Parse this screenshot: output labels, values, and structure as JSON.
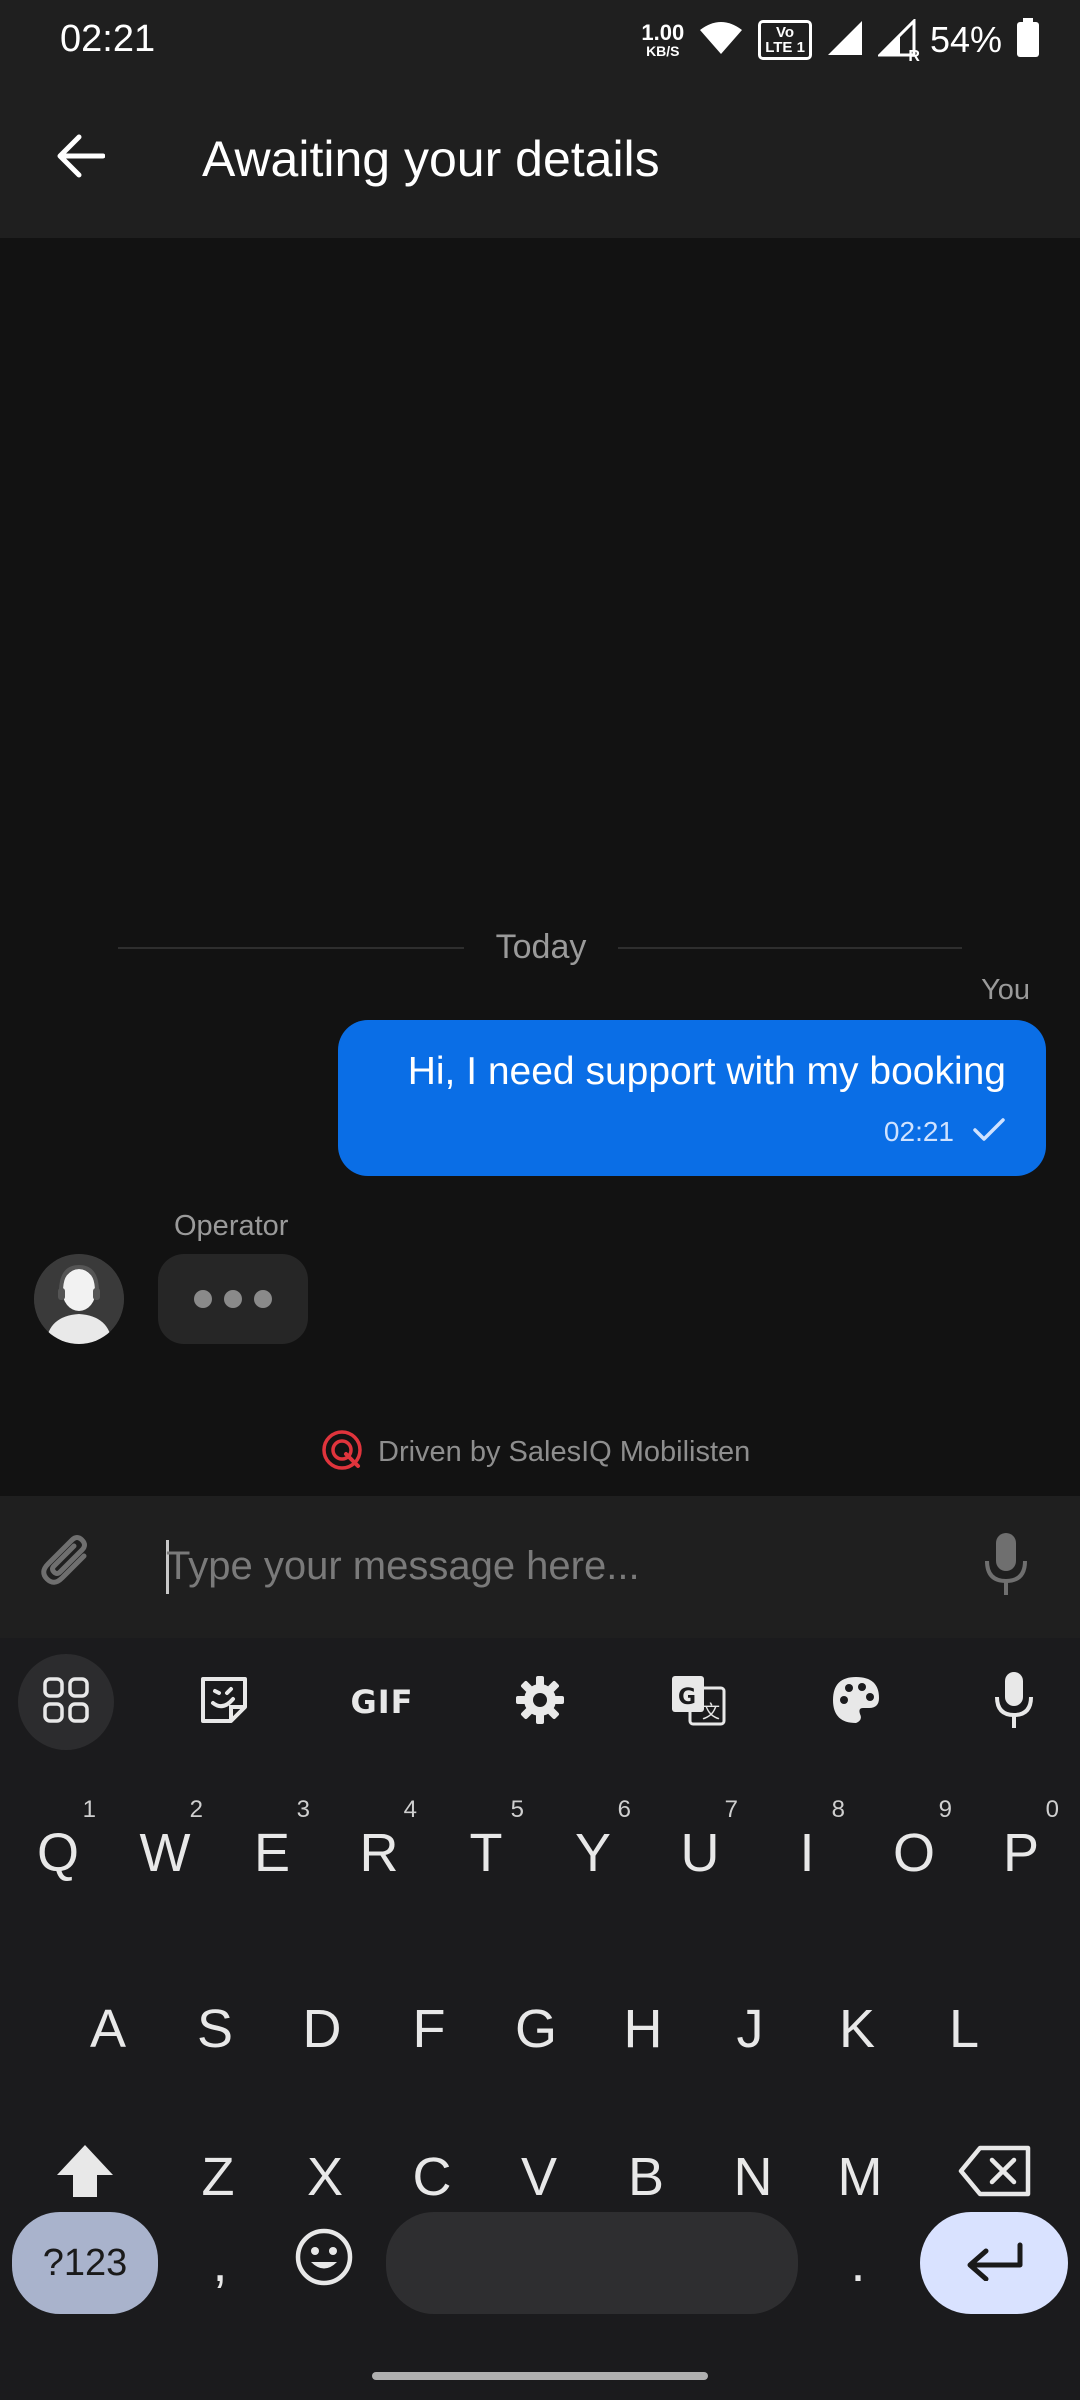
{
  "status_bar": {
    "time": "02:21",
    "net_speed_value": "1.00",
    "net_speed_unit": "KB/S",
    "volte_label_line1": "Vo",
    "volte_label_line2": "LTE 1",
    "signal_roaming": "R",
    "battery_percent": "54%",
    "icons": [
      "wifi-icon",
      "signal-icon",
      "signal-roaming-icon",
      "battery-icon"
    ]
  },
  "app_bar": {
    "title": "Awaiting your details",
    "back_icon": "arrow-left-icon"
  },
  "chat": {
    "date_separator": "Today",
    "messages": [
      {
        "sender_label": "You",
        "text": "Hi, I need support with my booking",
        "time": "02:21",
        "status_icon": "check-icon"
      }
    ],
    "operator_label": "Operator",
    "typing_indicator": "typing-dots",
    "powered_by": "Driven by SalesIQ Mobilisten"
  },
  "composer": {
    "placeholder": "Type your message here...",
    "attach_icon": "paperclip-icon",
    "mic_icon": "microphone-icon"
  },
  "keyboard": {
    "toolbar": [
      "apps-grid-icon",
      "sticker-icon",
      "GIF",
      "settings-icon",
      "translate-icon",
      "palette-icon",
      "microphone-icon"
    ],
    "gif_label": "GIF",
    "row1": [
      {
        "key": "Q",
        "hint": "1"
      },
      {
        "key": "W",
        "hint": "2"
      },
      {
        "key": "E",
        "hint": "3"
      },
      {
        "key": "R",
        "hint": "4"
      },
      {
        "key": "T",
        "hint": "5"
      },
      {
        "key": "Y",
        "hint": "6"
      },
      {
        "key": "U",
        "hint": "7"
      },
      {
        "key": "I",
        "hint": "8"
      },
      {
        "key": "O",
        "hint": "9"
      },
      {
        "key": "P",
        "hint": "0"
      }
    ],
    "row2": [
      "A",
      "S",
      "D",
      "F",
      "G",
      "H",
      "J",
      "K",
      "L"
    ],
    "row3": [
      "Z",
      "X",
      "C",
      "V",
      "B",
      "N",
      "M"
    ],
    "symbols_key": "?123",
    "comma_key": ",",
    "period_key": ".",
    "colors": {
      "accent_bubble": "#0a6ee6",
      "symbols_key_bg": "#a9b3cc",
      "enter_key_bg": "#d9e2ff"
    }
  }
}
